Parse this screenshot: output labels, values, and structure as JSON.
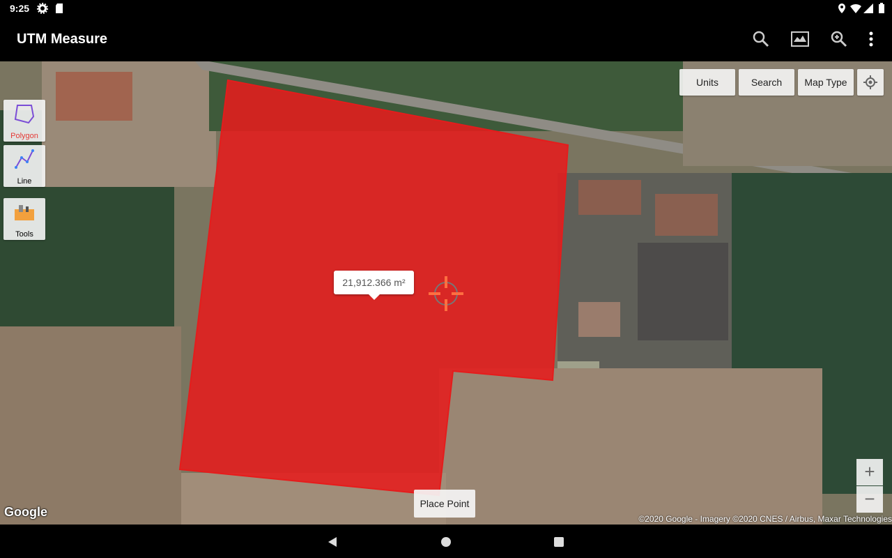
{
  "status": {
    "time": "9:25"
  },
  "app": {
    "title": "UTM Measure",
    "actions": [
      "search-icon",
      "map-layers-icon",
      "zoom-search-icon",
      "more-vert-icon"
    ]
  },
  "map_controls": {
    "units_label": "Units",
    "search_label": "Search",
    "map_type_label": "Map Type"
  },
  "tools": {
    "polygon_label": "Polygon",
    "line_label": "Line",
    "tools_label": "Tools"
  },
  "measurement": {
    "area_label": "21,912.366 m²"
  },
  "place_point_label": "Place Point",
  "zoom": {
    "in_label": "+",
    "out_label": "−"
  },
  "map_footer": {
    "logo": "Google",
    "attribution": "©2020 Google - Imagery ©2020 CNES / Airbus, Maxar Technologies"
  },
  "colors": {
    "polygon_fill": "#e51c1c",
    "polygon_active_label": "#e53935",
    "crosshair": "#ff6e40"
  }
}
